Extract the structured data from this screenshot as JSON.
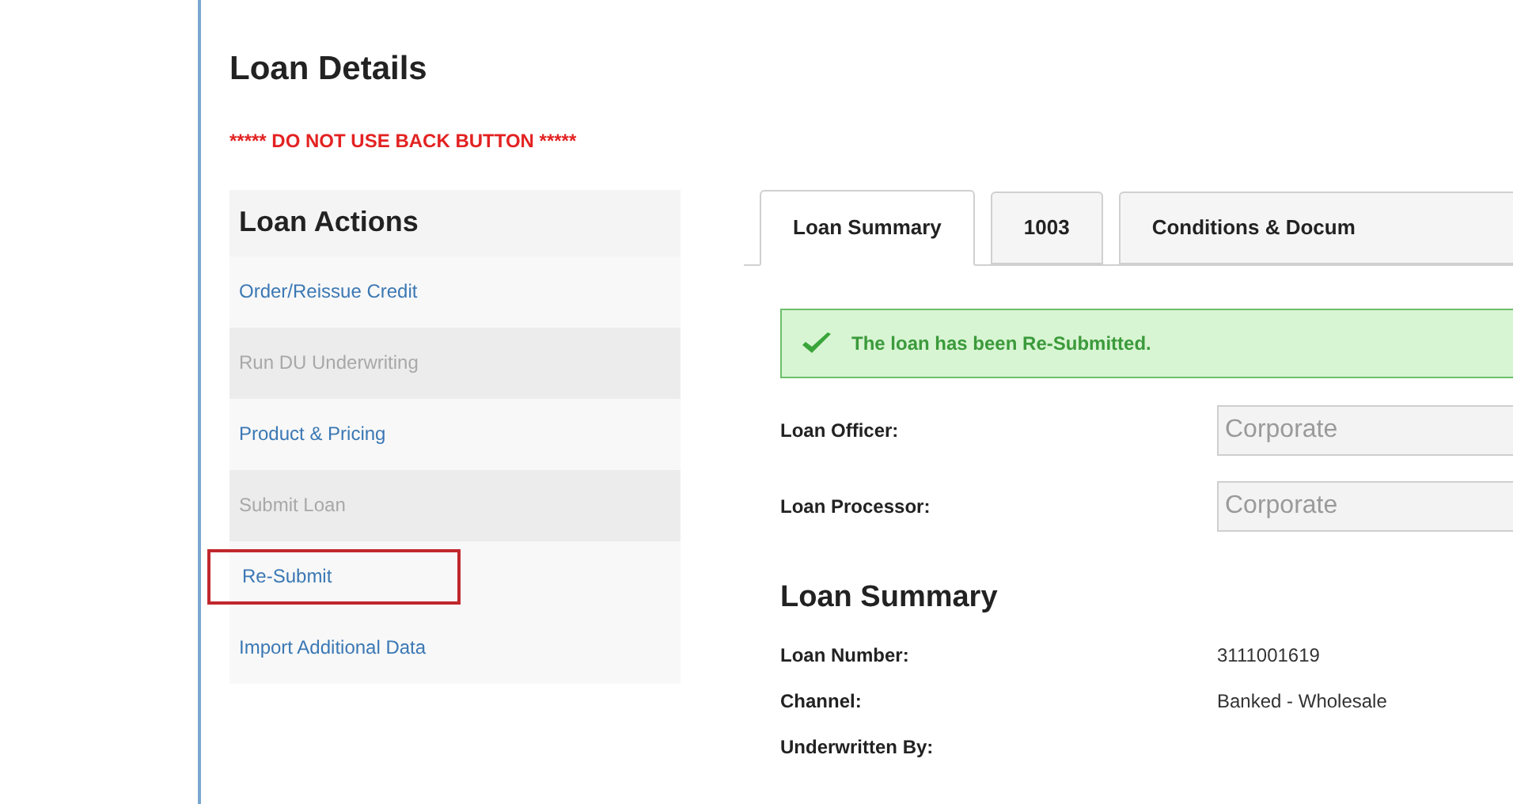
{
  "page": {
    "title": "Loan Details",
    "warning": "***** DO NOT USE BACK BUTTON *****"
  },
  "sidebar": {
    "title": "Loan Actions",
    "items": [
      {
        "label": "Order/Reissue Credit",
        "disabled": false,
        "selected": false
      },
      {
        "label": "Run DU Underwriting",
        "disabled": true,
        "selected": false
      },
      {
        "label": "Product & Pricing",
        "disabled": false,
        "selected": false
      },
      {
        "label": "Submit Loan",
        "disabled": true,
        "selected": false
      },
      {
        "label": "Re-Submit",
        "disabled": false,
        "selected": true
      },
      {
        "label": "Import Additional Data",
        "disabled": false,
        "selected": false
      }
    ]
  },
  "tabs": [
    {
      "label": "Loan Summary",
      "selected": true
    },
    {
      "label": "1003",
      "selected": false
    },
    {
      "label": "Conditions & Docum",
      "selected": false
    }
  ],
  "alert": {
    "text": "The loan has been Re-Submitted."
  },
  "fields": [
    {
      "label": "Loan Officer:",
      "value": "Corporate",
      "disabled": true
    },
    {
      "label": "Loan Processor:",
      "value": "Corporate",
      "disabled": true
    }
  ],
  "summary": {
    "title": "Loan Summary",
    "rows": [
      {
        "label": "Loan Number:",
        "value": "3111001619"
      },
      {
        "label": "Channel:",
        "value": "Banked - Wholesale"
      },
      {
        "label": "Underwritten By:"
      }
    ]
  }
}
